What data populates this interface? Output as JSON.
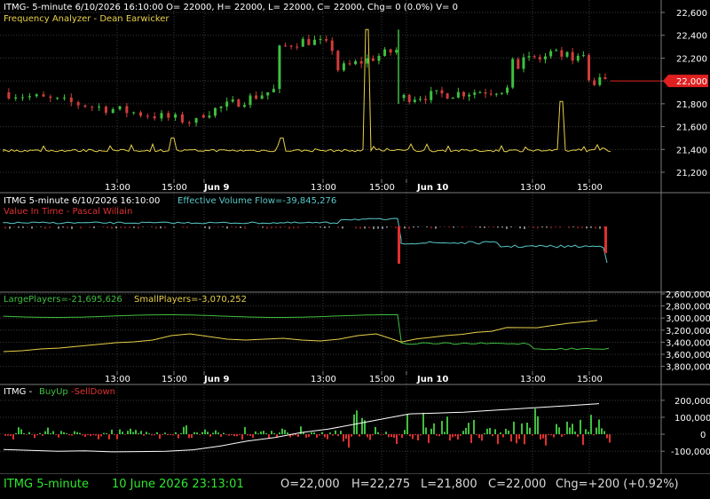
{
  "colors": {
    "background": "#000000",
    "grid": "#3a3a3a",
    "frame": "#7a7a7a",
    "text": "#ffffff",
    "up": "#3fbf3f",
    "down": "#d23c3c",
    "yellow": "#e8d04a",
    "cyan": "#58c8c8",
    "green": "#3fbf3f",
    "red": "#e03030",
    "white": "#ffffff",
    "status_green": "#2ee82e",
    "price_tag": "#e02020"
  },
  "time_axis": {
    "labels": [
      "13:00",
      "15:00",
      "Jun 9",
      "13:00",
      "15:00",
      "Jun 10",
      "13:00",
      "15:00"
    ],
    "bold": [
      false,
      false,
      true,
      false,
      false,
      true,
      false,
      false
    ]
  },
  "panels": {
    "price": {
      "title": "ITMG- 5-minute 6/10/2026 16:10:00 O= 22000, H= 22000, L= 22000, C= 22000, Chg= 0 (0.0%) V= 0",
      "subtitle": "Frequency Analyzer - Dean Earwicker",
      "y_ticks": [
        "22,600",
        "22,400",
        "22,200",
        "22,000",
        "21,800",
        "21,600",
        "21,400",
        "21,200"
      ],
      "last_price_label": "22,000"
    },
    "volume_flow": {
      "title_prefix": "ITMG 5-minute  6/10/2026 16:10:00",
      "title_suffix": "Effective Volume Flow=-39,845,276",
      "subtitle": "Value In Time - Pascal Willain"
    },
    "players": {
      "large_label": "LargePlayers=-21,695,626",
      "small_label": "SmallPlayers=-3,070,252",
      "y_ticks": [
        "2,600,000",
        "2,800,000",
        "3,000,000",
        "3,200,000",
        "3,400,000",
        "3,600,000",
        "3,800,000"
      ]
    },
    "buyup": {
      "title_prefix": "ITMG - ",
      "buy_label": "BuyUp",
      "sell_label": "-SellDown",
      "y_ticks": [
        "200,000",
        "100,000",
        "0",
        "-100,000"
      ]
    }
  },
  "status_bar": {
    "symbol": "ITMG  5-minute",
    "datetime": "10 June 2026 23:13:01",
    "open": "O=22,000",
    "high": "H=22,275",
    "low": "L=21,800",
    "close": "C=22,000",
    "change": "Chg=+200 (+0.92%)"
  },
  "chart_data": [
    {
      "type": "candlestick",
      "series_name": "ITMG",
      "ylim": [
        21200,
        22600
      ],
      "segments": [
        {
          "day": "start",
          "points": 28,
          "open": 21900,
          "close": 21640,
          "high": 21950,
          "low": 21600
        },
        {
          "day": "Jun 9",
          "points": 34,
          "open": 21700,
          "close": 22270,
          "high": 22410,
          "low": 21600
        },
        {
          "day": "Jun 10",
          "points": 38,
          "open": 21850,
          "close": 22000,
          "high": 22450,
          "low": 21800
        }
      ],
      "last_price": 22000
    },
    {
      "type": "line",
      "name": "Frequency Analyzer - Dean Earwicker",
      "baseline": 21380,
      "spikes": [
        {
          "x": 0.28,
          "value": 21500
        },
        {
          "x": 0.46,
          "value": 21500
        },
        {
          "x": 0.6,
          "value": 22450
        },
        {
          "x": 0.92,
          "value": 21820
        }
      ]
    },
    {
      "type": "line",
      "name": "Effective Volume Flow",
      "last_value": -39845276
    },
    {
      "type": "line",
      "series": [
        {
          "name": "LargePlayers",
          "last_value": -21695626
        },
        {
          "name": "SmallPlayers",
          "last_value": -3070252
        }
      ],
      "ylim": [
        2600000,
        3800000
      ]
    },
    {
      "type": "bar",
      "name": "BuyUp-SellDown",
      "ylim": [
        -120000,
        220000
      ],
      "y_ticks": [
        200000,
        100000,
        0,
        -100000
      ]
    }
  ]
}
